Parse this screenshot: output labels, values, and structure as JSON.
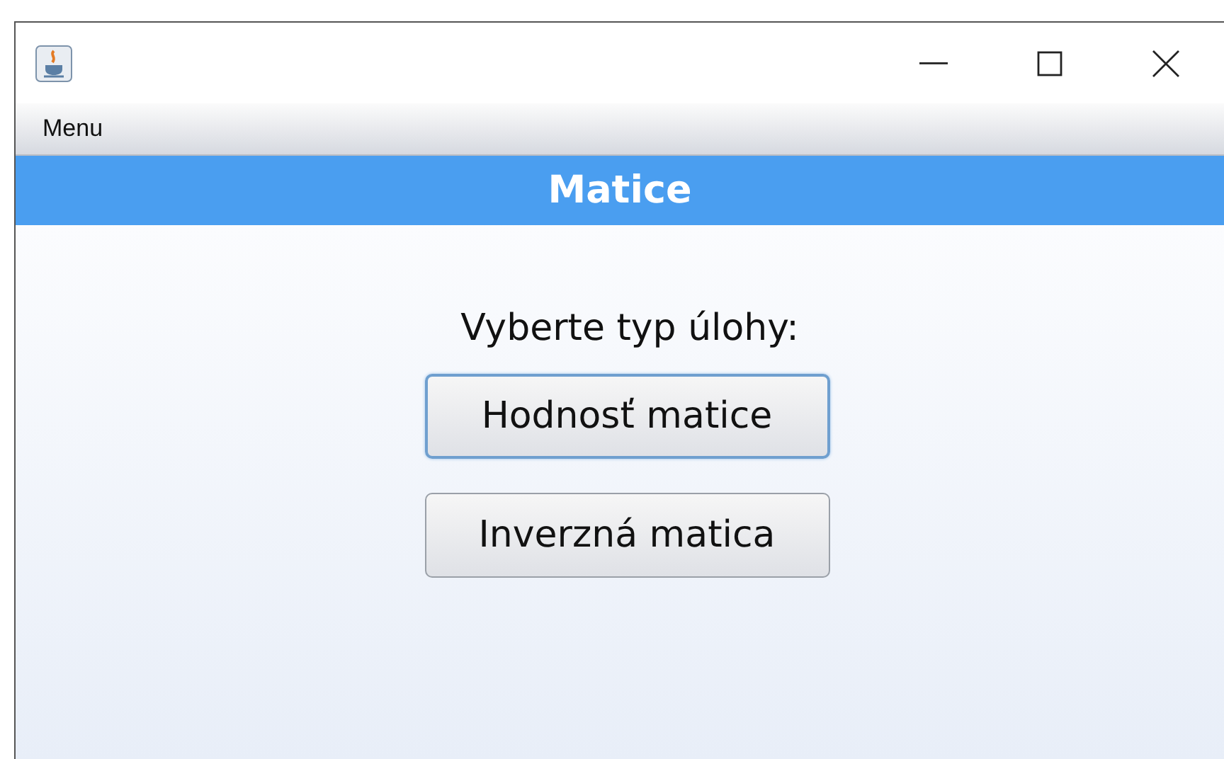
{
  "menu_bar": {
    "items": [
      "Menu"
    ]
  },
  "header": {
    "title": "Matice"
  },
  "content": {
    "prompt": "Vyberte typ úlohy:",
    "buttons": [
      {
        "label": "Hodnosť matice",
        "focused": true
      },
      {
        "label": "Inverzná matica",
        "focused": false
      }
    ]
  }
}
